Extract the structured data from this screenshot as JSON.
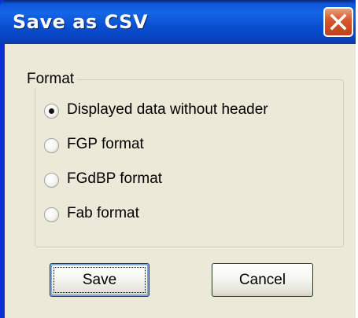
{
  "window": {
    "title": "Save as CSV",
    "close_icon": "close-icon"
  },
  "format_group": {
    "legend": "Format",
    "selected_index": 0,
    "options": [
      {
        "label": "Displayed data without header",
        "selected": true
      },
      {
        "label": "FGP format",
        "selected": false
      },
      {
        "label": "FGdBP format",
        "selected": false
      },
      {
        "label": "Fab format",
        "selected": false
      }
    ]
  },
  "buttons": {
    "save_label": "Save",
    "cancel_label": "Cancel"
  },
  "colors": {
    "titlebar_blue": "#0c55d8",
    "close_red": "#d85a2a",
    "dialog_face": "#ece9d8"
  }
}
